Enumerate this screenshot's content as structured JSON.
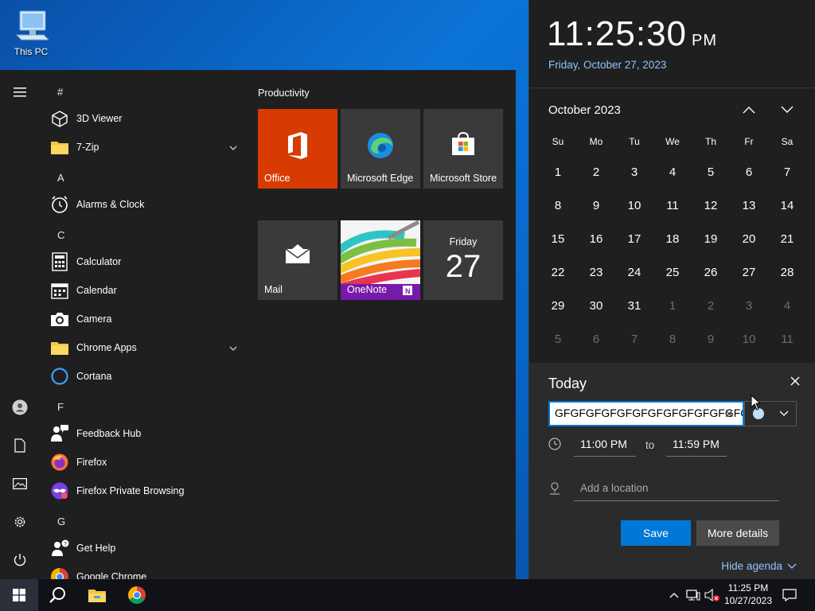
{
  "desktop": {
    "this_pc_label": "This PC"
  },
  "start_menu": {
    "letters": {
      "hash": "#",
      "a": "A",
      "c": "C",
      "f": "F",
      "g": "G"
    },
    "apps": {
      "viewer3d": "3D Viewer",
      "zip7": "7-Zip",
      "alarms": "Alarms & Clock",
      "calculator": "Calculator",
      "calendar": "Calendar",
      "camera": "Camera",
      "chrome_apps": "Chrome Apps",
      "cortana": "Cortana",
      "feedback": "Feedback Hub",
      "firefox": "Firefox",
      "firefox_private": "Firefox Private Browsing",
      "get_help": "Get Help",
      "google_chrome": "Google Chrome"
    },
    "tiles": {
      "group_title": "Productivity",
      "office": "Office",
      "edge": "Microsoft Edge",
      "store": "Microsoft Store",
      "mail": "Mail",
      "onenote": "OneNote",
      "calendar_day": "Friday",
      "calendar_date": "27"
    }
  },
  "flyout": {
    "time": "11:25:30",
    "ampm": "PM",
    "long_date": "Friday, October 27, 2023",
    "month_title": "October 2023",
    "weekdays": [
      "Su",
      "Mo",
      "Tu",
      "We",
      "Th",
      "Fr",
      "Sa"
    ],
    "weeks": [
      [
        "1",
        "2",
        "3",
        "4",
        "5",
        "6",
        "7"
      ],
      [
        "8",
        "9",
        "10",
        "11",
        "12",
        "13",
        "14"
      ],
      [
        "15",
        "16",
        "17",
        "18",
        "19",
        "20",
        "21"
      ],
      [
        "22",
        "23",
        "24",
        "25",
        "26",
        "27",
        "28"
      ],
      [
        "29",
        "30",
        "31",
        "1",
        "2",
        "3",
        "4"
      ],
      [
        "5",
        "6",
        "7",
        "8",
        "9",
        "10",
        "11"
      ]
    ],
    "selected_day": "27",
    "agenda": {
      "today_label": "Today",
      "event_title_value": "GFGFGFGFGFGFGFGFGFGFGFGFGFG",
      "start_time": "11:00 PM",
      "to_label": "to",
      "end_time": "11:59 PM",
      "location_placeholder": "Add a location",
      "save_label": "Save",
      "more_details_label": "More details",
      "hide_agenda_label": "Hide agenda"
    }
  },
  "taskbar": {
    "tray_time": "11:25 PM",
    "tray_date": "10/27/2023"
  },
  "colors": {
    "office_tile": "#d83b01",
    "accent": "#0078d7",
    "link": "#8fc4ff",
    "onenote_band": "#7719aa"
  }
}
